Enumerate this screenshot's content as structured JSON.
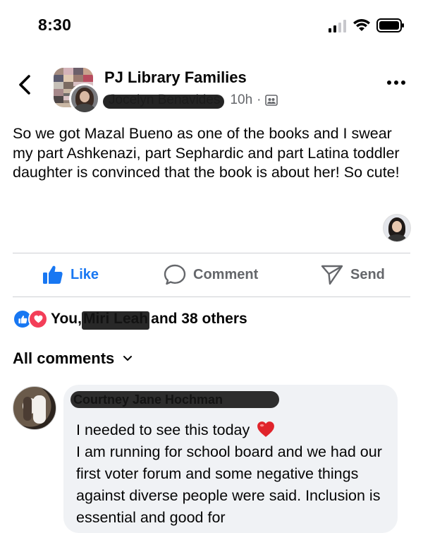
{
  "status_bar": {
    "time": "8:30"
  },
  "post": {
    "group_name": "PJ Library Families",
    "author": "Jocelyn Benavides",
    "time_ago": "10h",
    "separator": "·",
    "text": "So we got Mazal Bueno as one of the books and I swear my part Ashkenazi, part Sephardic and part Latina toddler daughter is convinced that the book is about her! So cute!"
  },
  "actions": {
    "like": "Like",
    "comment": "Comment",
    "send": "Send"
  },
  "reactions": {
    "prefix": "You,",
    "name": "Miri Leah",
    "suffix": "and 38 others"
  },
  "comments_header": {
    "label": "All comments"
  },
  "comment": {
    "author": "Courtney Jane Hochman",
    "line1": "I needed to see this today",
    "body": "I am running for school board and we had our first voter forum and some negative things against diverse people were said. Inclusion is essential and good for"
  },
  "colors": {
    "accent": "#1877f2",
    "love": "#f33e58",
    "muted": "#65676b",
    "bubble": "#f0f2f5"
  }
}
